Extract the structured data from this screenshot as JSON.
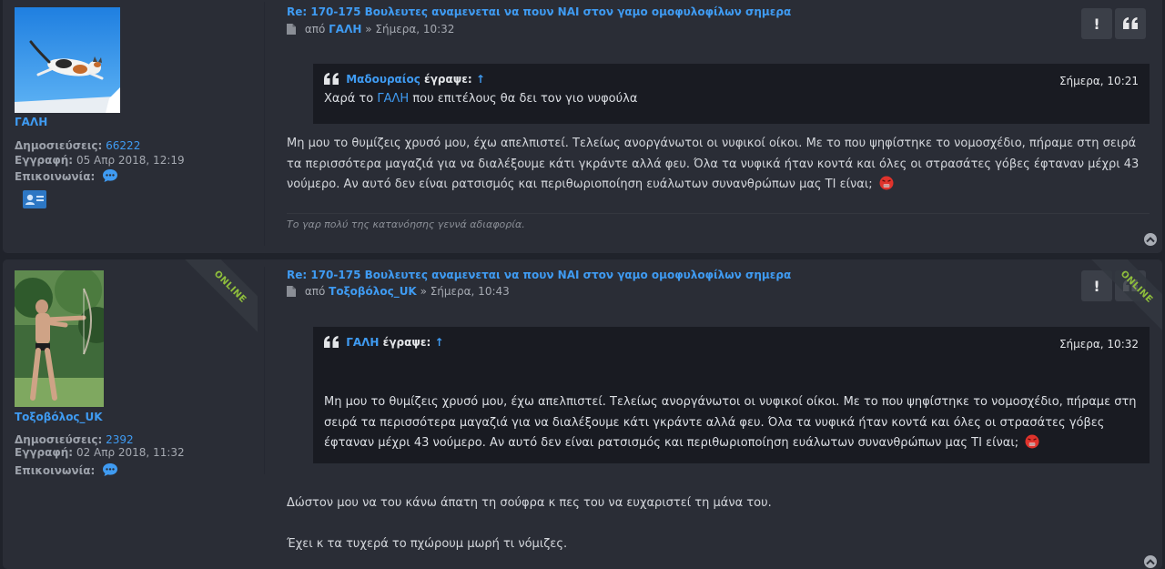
{
  "posts": [
    {
      "title": "Re: 170-175 Βουλευτες αναμενεται να πουν ΝΑΙ στον γαμο ομοφυλοφίλων σημερα",
      "by_prefix": "από",
      "author": "ΓΑΛΗ",
      "datetime": "» Σήμερα, 10:32",
      "profile": {
        "username": "ΓΑΛΗ",
        "posts_label": "Δημοσιεύσεις:",
        "posts_value": "66222",
        "joined_label": "Εγγραφή:",
        "joined_value": "05 Απρ 2018, 12:19",
        "contact_label": "Επικοινωνία:",
        "online": false
      },
      "quote": {
        "author": "Μαδουραίος",
        "wrote": "έγραψε:",
        "arrow": "↑",
        "time": "Σήμερα, 10:21",
        "text_before": "Χαρά το",
        "text_highlight": "ΓΑΛΗ",
        "text_after": "που επιτέλους θα δει τον γιο νυφούλα"
      },
      "body": "Μη μου το θυμίζεις χρυσό μου, έχω απελπιστεί. Τελείως ανοργάνωτοι οι νυφικοί οίκοι. Με το που ψηφίστηκε το νομοσχέδιο, πήραμε στη σειρά τα περισσότερα μαγαζιά για να διαλέξουμε κάτι γκράντε αλλά φευ. Όλα τα νυφικά ήταν κοντά και όλες οι στρασάτες γόβες έφταναν μέχρι 43 νούμερο. Αν αυτό δεν είναι ρατσισμός και περιθωριοποίηση ευάλωτων συνανθρώπων μας ΤΙ είναι;",
      "signature": "Το γαρ πολύ της κατανόησης γεννά αδιαφορία."
    },
    {
      "title": "Re: 170-175 Βουλευτες αναμενεται να πουν ΝΑΙ στον γαμο ομοφυλοφίλων σημερα",
      "by_prefix": "από",
      "author": "Τοξοβόλος_UK",
      "datetime": "» Σήμερα, 10:43",
      "profile": {
        "username": "Τοξοβόλος_UK",
        "posts_label": "Δημοσιεύσεις:",
        "posts_value": "2392",
        "joined_label": "Εγγραφή:",
        "joined_value": "02 Απρ 2018, 11:32",
        "contact_label": "Επικοινωνία:",
        "online": true
      },
      "quote": {
        "author": "ΓΑΛΗ",
        "wrote": "έγραψε:",
        "arrow": "↑",
        "time": "Σήμερα, 10:32",
        "text": "Μη μου το θυμίζεις χρυσό μου, έχω απελπιστεί. Τελείως ανοργάνωτοι οι νυφικοί οίκοι. Με το που ψηφίστηκε το νομοσχέδιο, πήραμε στη σειρά τα περισσότερα μαγαζιά για να διαλέξουμε κάτι γκράντε αλλά φευ. Όλα τα νυφικά ήταν κοντά και όλες οι στρασάτες γόβες έφταναν μέχρι 43 νούμερο. Αν αυτό δεν είναι ρατσισμός και περιθωριοποίηση ευάλωτων συνανθρώπων μας ΤΙ είναι;"
      },
      "body_lines": [
        "Δώστον μου να του κάνω άπατη τη σούφρα κ πες του να ευχαριστεί τη μάνα του.",
        "Έχει κ τα τυχερά το πχώρουμ μωρή τι νόμιζες."
      ]
    }
  ],
  "online_label": "ONLINE",
  "buttons": {
    "report": "!",
    "quote": "❝"
  },
  "colors": {
    "link": "#3f9bf2",
    "background": "#20232b",
    "post_bg": "#2a2d36",
    "quote_bg": "#191b22",
    "online": "#8fbf3c"
  },
  "icons": [
    "document-icon",
    "quote-icon",
    "chat-bubble-icon",
    "contact-card-icon",
    "angry-emoji-icon",
    "back-to-top-icon"
  ]
}
